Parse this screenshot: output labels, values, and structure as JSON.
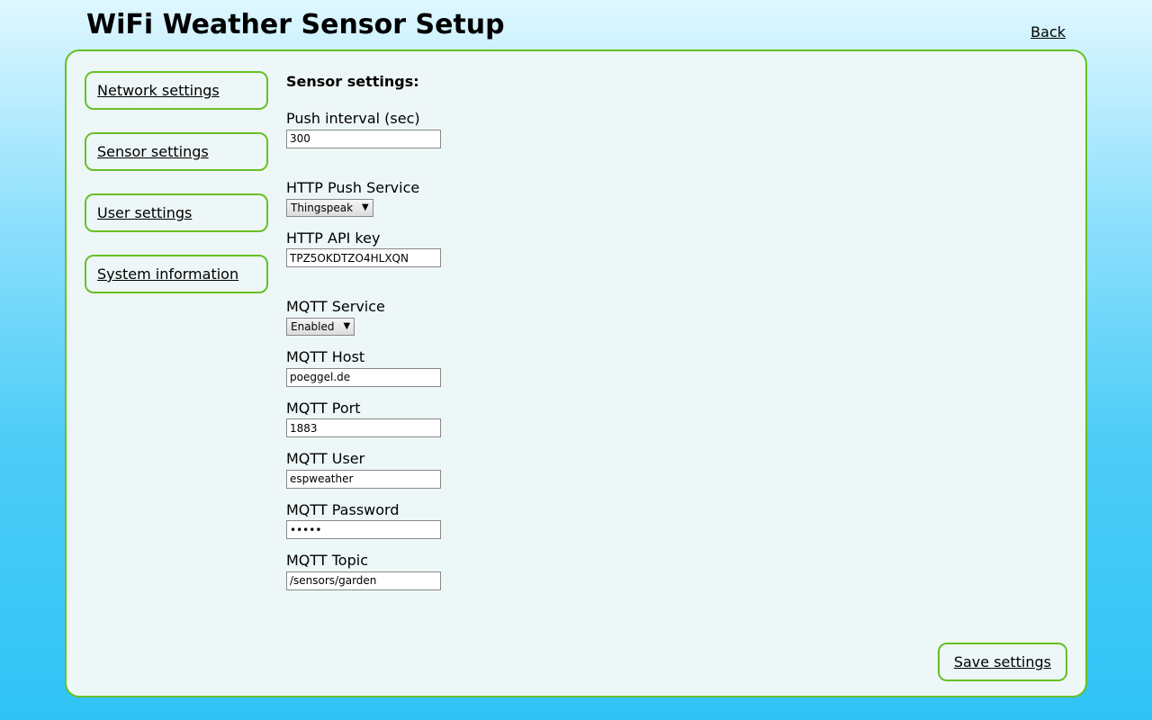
{
  "header": {
    "title": "WiFi Weather Sensor Setup",
    "back": "Back"
  },
  "sidebar": {
    "items": [
      {
        "label": "Network settings"
      },
      {
        "label": "Sensor settings"
      },
      {
        "label": "User settings"
      },
      {
        "label": "System information"
      }
    ]
  },
  "main": {
    "heading": "Sensor settings:",
    "push_interval_label": "Push interval (sec)",
    "push_interval_value": "300",
    "http_service_label": "HTTP Push Service",
    "http_service_value": "Thingspeak",
    "http_api_key_label": "HTTP API key",
    "http_api_key_value": "TPZ5OKDTZO4HLXQN",
    "mqtt_service_label": "MQTT Service",
    "mqtt_service_value": "Enabled",
    "mqtt_host_label": "MQTT Host",
    "mqtt_host_value": "poeggel.de",
    "mqtt_port_label": "MQTT Port",
    "mqtt_port_value": "1883",
    "mqtt_user_label": "MQTT User",
    "mqtt_user_value": "espweather",
    "mqtt_password_label": "MQTT Password",
    "mqtt_password_value": "•••••",
    "mqtt_topic_label": "MQTT Topic",
    "mqtt_topic_value": "/sensors/garden"
  },
  "footer": {
    "save": "Save settings"
  }
}
